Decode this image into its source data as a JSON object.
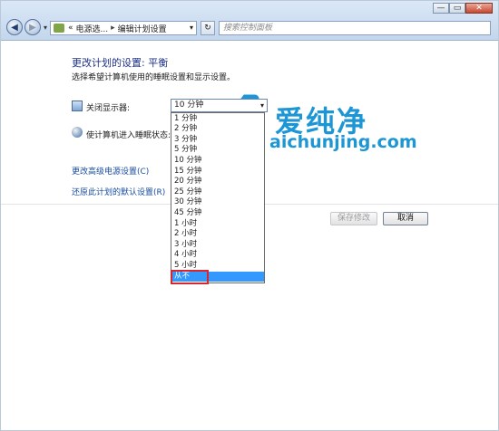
{
  "window": {
    "minimize": "—",
    "maximize": "▭",
    "close": "✕"
  },
  "address_bar": {
    "prefix": "«",
    "crumb1": "电源选...",
    "separator": "▸",
    "crumb2": "编辑计划设置",
    "refresh": "↻",
    "search_placeholder": "搜索控制面板"
  },
  "content": {
    "title": "更改计划的设置: 平衡",
    "subtitle": "选择希望计算机使用的睡眠设置和显示设置。",
    "display_label": "关闭显示器:",
    "sleep_label": "使计算机进入睡眠状态:",
    "link_advanced": "更改高级电源设置(C)",
    "link_restore": "还原此计划的默认设置(R)",
    "save_button": "保存修改",
    "cancel_button": "取消"
  },
  "select": {
    "value": "10 分钟",
    "arrow": "▾",
    "options": [
      "1 分钟",
      "2 分钟",
      "3 分钟",
      "5 分钟",
      "10 分钟",
      "15 分钟",
      "20 分钟",
      "25 分钟",
      "30 分钟",
      "45 分钟",
      "1 小时",
      "2 小时",
      "3 小时",
      "4 小时",
      "5 小时",
      "从不"
    ],
    "highlighted": "从不"
  },
  "watermark": {
    "chinese": "爱纯净",
    "domain": "aichunjing.com",
    "color": "#1d96d6"
  }
}
